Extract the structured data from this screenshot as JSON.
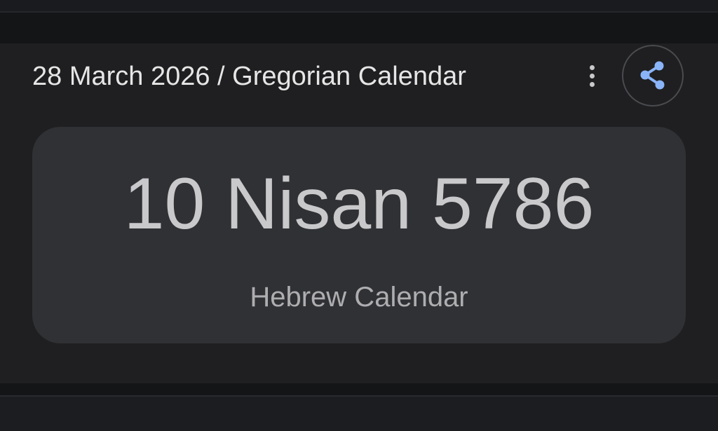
{
  "header": {
    "title": "28 March 2026 / Gregorian Calendar",
    "more_icon": "more-vert-icon",
    "share_icon": "share-icon"
  },
  "result": {
    "value": "10 Nisan 5786",
    "label": "Hebrew Calendar"
  },
  "colors": {
    "background": "#141517",
    "card": "#1f1f21",
    "result_box": "#303134",
    "share_accent": "#8ab4f8",
    "text_primary": "#e6e6e6",
    "text_secondary": "#aeaeb1"
  }
}
